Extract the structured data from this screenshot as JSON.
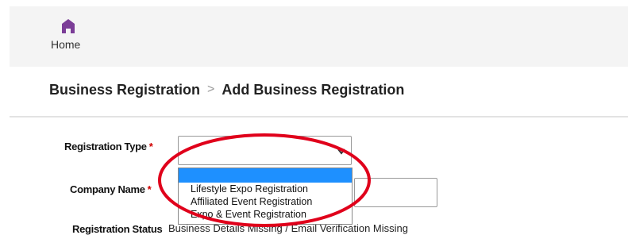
{
  "header": {
    "home_label": "Home",
    "home_icon": "home-icon",
    "accent": "#7b3d97"
  },
  "breadcrumb": {
    "parent": "Business Registration",
    "separator": ">",
    "current": "Add Business Registration"
  },
  "form": {
    "registration_type": {
      "label": "Registration Type",
      "required_mark": "*",
      "value": "",
      "options": [
        "",
        "Lifestyle Expo Registration",
        "Affiliated Event Registration",
        "Expo & Event Registration"
      ],
      "highlighted_option_color": "#1e90ff"
    },
    "company_name": {
      "label": "Company Name",
      "required_mark": "*",
      "value": ""
    },
    "registration_status": {
      "label": "Registration Status",
      "value": "Business Details Missing / Email Verification Missing"
    }
  },
  "annotation": {
    "color": "#e0001b"
  }
}
